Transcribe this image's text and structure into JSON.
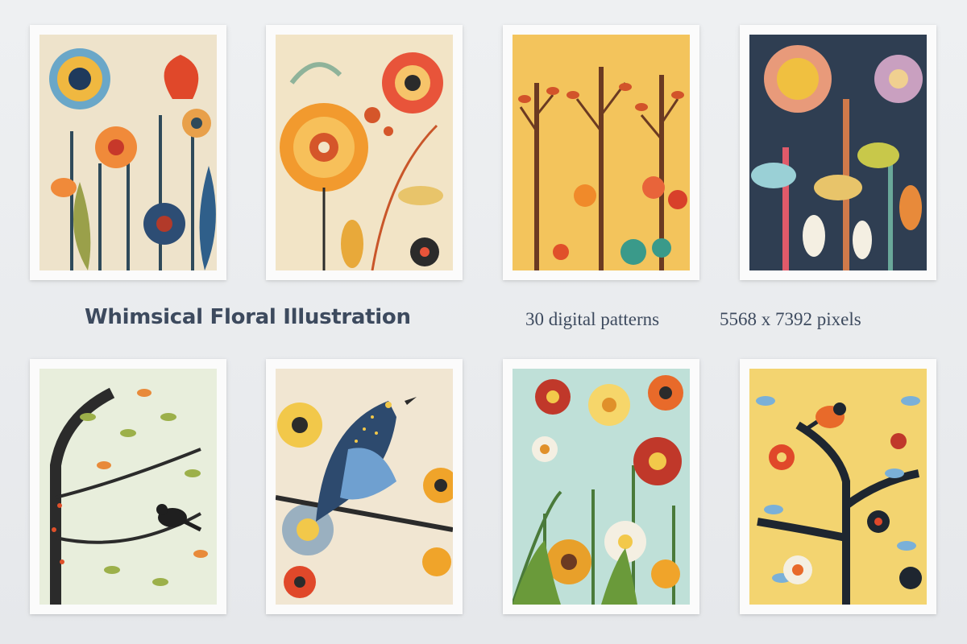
{
  "headline": "Whimsical Floral Illustration",
  "specs": {
    "count": "30 digital patterns",
    "size": "5568 x 7392 pixels"
  },
  "colors": {
    "background": "#eaecef",
    "text": "#3d4a5e",
    "card": "#fbfbfb"
  },
  "artworks": [
    {
      "subject": "folk flowers on cream"
    },
    {
      "subject": "orange blooms and leaves"
    },
    {
      "subject": "autumn trees on yellow"
    },
    {
      "subject": "flowers and leaves on navy"
    },
    {
      "subject": "tree branches with small bird"
    },
    {
      "subject": "blue bird on branch"
    },
    {
      "subject": "wildflower meadow"
    },
    {
      "subject": "tree with bird on yellow"
    }
  ]
}
